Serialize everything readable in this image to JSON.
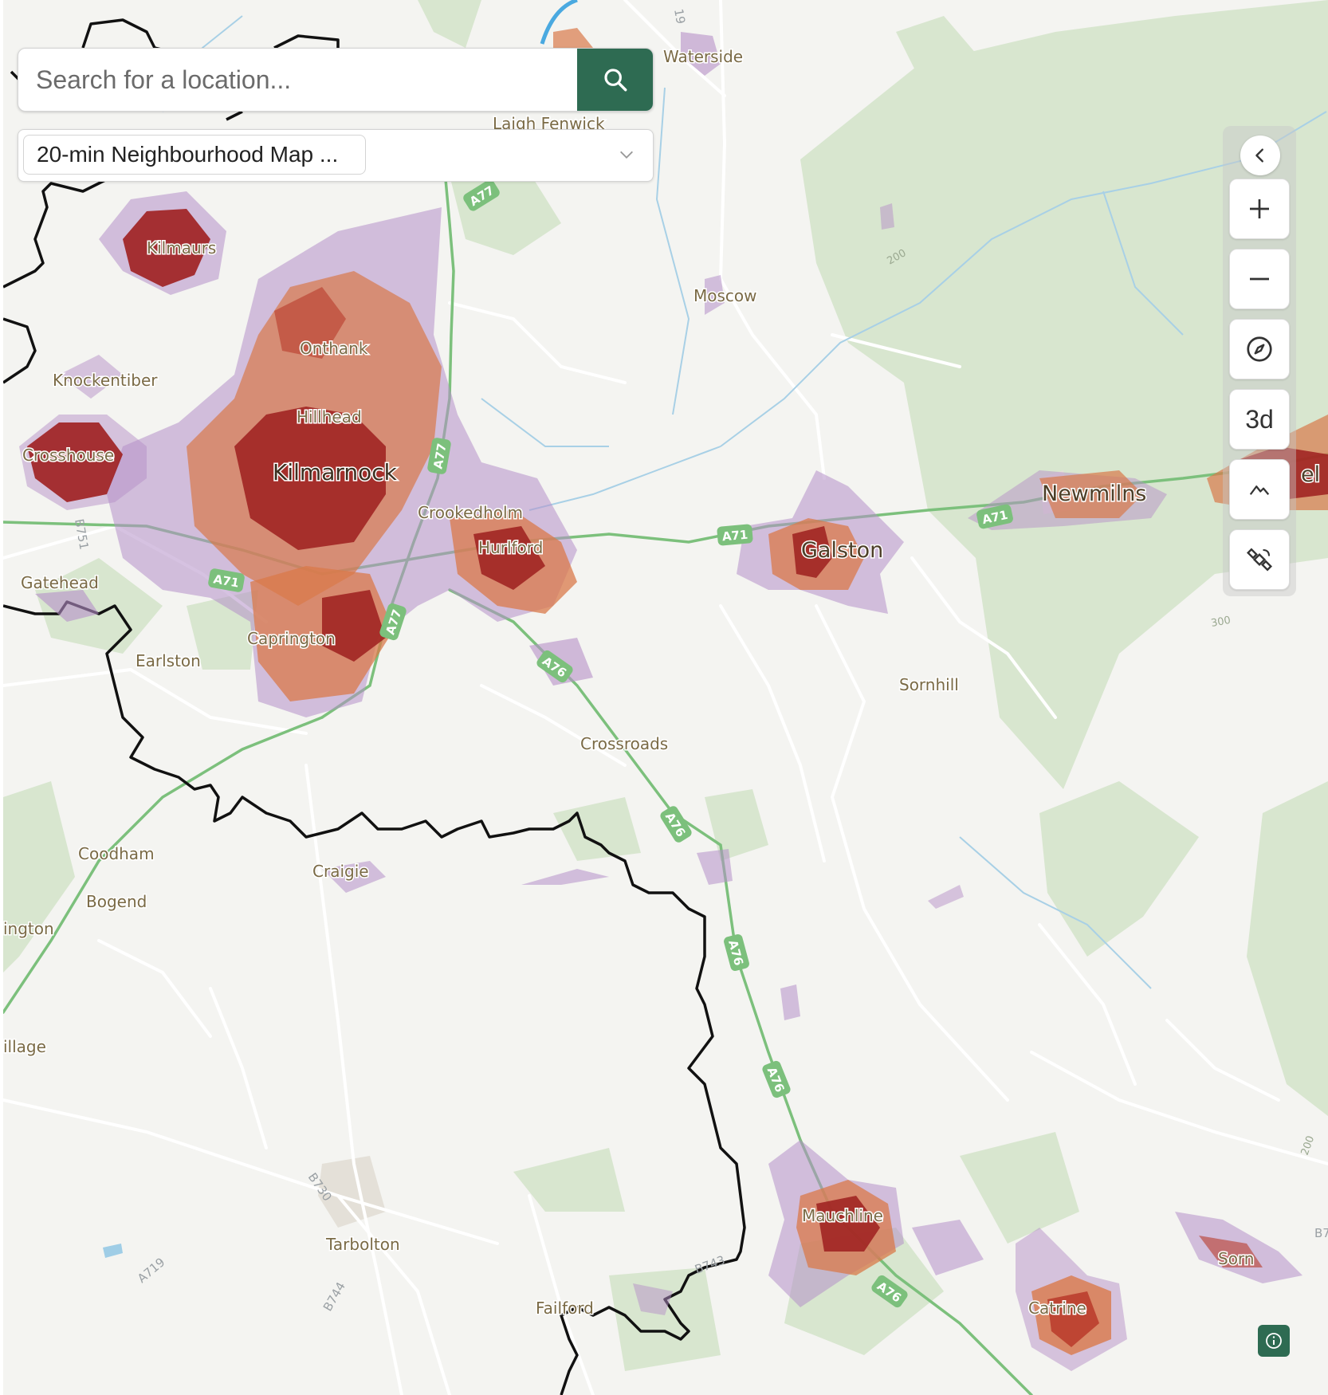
{
  "search": {
    "placeholder": "Search for a location..."
  },
  "layer_select": {
    "selected": "20-min Neighbourhood Map ..."
  },
  "controls": {
    "three_d_label": "3d"
  },
  "places": {
    "waterside": "Waterside",
    "laigh_fenwick": "Laigh Fenwick",
    "kilmaurs": "Kilmaurs",
    "moscow": "Moscow",
    "onthank": "Onthank",
    "knockentiber": "Knockentiber",
    "hillhead": "Hillhead",
    "crosshouse": "Crosshouse",
    "kilmarnock": "Kilmarnock",
    "crookedholm": "Crookedholm",
    "hurlford": "Hurlford",
    "newmilns": "Newmilns",
    "galston": "Galston",
    "darvel_partial": "el",
    "gatehead": "Gatehead",
    "caprington": "Caprington",
    "earlston": "Earlston",
    "sornhill": "Sornhill",
    "crossroads": "Crossroads",
    "coodham": "Coodham",
    "craigie": "Craigie",
    "bogend": "Bogend",
    "symington_partial": "ington",
    "village_partial": "illage",
    "mauchline": "Mauchline",
    "tarbolton": "Tarbolton",
    "sorn": "Sorn",
    "failford": "Failford",
    "catrine": "Catrine"
  },
  "roads": {
    "a77": "A77",
    "a71": "A71",
    "a76": "A76",
    "b751": "B751",
    "b730": "B730",
    "a719": "A719",
    "b744": "B744",
    "b743": "B743",
    "b7_partial": "B7",
    "b_partial": "19"
  },
  "contours": {
    "c200": "200",
    "c300": "300"
  },
  "colors": {
    "accent": "#2e6b52",
    "high": "#9e1f1f",
    "mid": "#d9794a",
    "low": "#b58fc8"
  }
}
